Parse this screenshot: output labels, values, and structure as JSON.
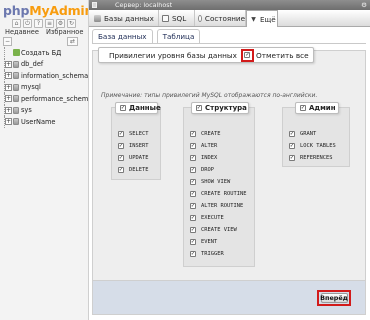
{
  "nav": {
    "logo_part1": "php",
    "logo_part2": "MyAdmin",
    "tabs": [
      "Недавнее",
      "Избранное"
    ],
    "new_db": "Создать БД",
    "databases": [
      "db_def",
      "information_schema",
      "mysql",
      "performance_schema",
      "sys",
      "UserName"
    ]
  },
  "topbar": {
    "server": "Сервер: localhost",
    "right_icon": "gear-icon"
  },
  "menu": {
    "tabs": [
      {
        "label": "Базы данных",
        "icon": "database-icon"
      },
      {
        "label": "SQL",
        "icon": "sql-icon"
      },
      {
        "label": "Состояние",
        "icon": "status-icon"
      },
      {
        "label": "Ещё",
        "icon": "chevron-down-icon"
      }
    ],
    "active_tab": "Ещё"
  },
  "subtabs": [
    "База данных",
    "Таблица"
  ],
  "fieldset": {
    "legend": "Привилегии уровня базы данных",
    "check_all_label": "Отметить все",
    "check_all_checked": true,
    "note": "Примечание: типы привилегий MySQL отображаются по-английски."
  },
  "groups": [
    {
      "title": "Данные",
      "checked": true,
      "privileges": [
        "SELECT",
        "INSERT",
        "UPDATE",
        "DELETE"
      ]
    },
    {
      "title": "Структура",
      "checked": true,
      "privileges": [
        "CREATE",
        "ALTER",
        "INDEX",
        "DROP",
        "SHOW VIEW",
        "CREATE ROUTINE",
        "ALTER ROUTINE",
        "EXECUTE",
        "CREATE VIEW",
        "EVENT",
        "TRIGGER"
      ]
    },
    {
      "title": "Админ",
      "checked": true,
      "privileges": [
        "GRANT",
        "LOCK TABLES",
        "REFERENCES"
      ]
    }
  ],
  "footer": {
    "go_label": "Вперёд"
  },
  "colors": {
    "highlight": "#d21b1b",
    "footer_bg": "#d6dde8",
    "logo_php": "#6c78af",
    "logo_myadmin": "#f89c0e"
  }
}
